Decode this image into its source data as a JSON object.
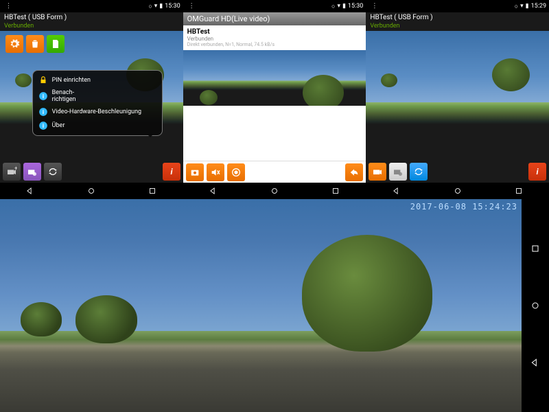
{
  "panel1": {
    "time": "15:30",
    "title": "HBTest ( USB Form )",
    "status": "Verbunden",
    "menu": {
      "pin": "PIN einrichten",
      "notify": "Benach-\nrichtigen",
      "hw": "Video-Hardware-Beschleunigung",
      "about": "Über"
    }
  },
  "panel2": {
    "time": "15:30",
    "header": "OMGuard HD(Live video)",
    "name": "HBTest",
    "conn_label": "Verbunden",
    "detail": "Direkt verbunden, N=1, Normal, 74.5 kB/s"
  },
  "panel3": {
    "time": "15:29",
    "title": "HBTest ( USB Form )",
    "status": "Verbunden"
  },
  "landscape": {
    "timestamp": "2017-06-08 15:24:23"
  },
  "icons": {
    "gear": "gear-icon",
    "trash": "trash-icon",
    "doc": "document-icon",
    "info": "info-icon",
    "camera_add": "camera-add-icon",
    "camera_settings": "camera-settings-icon",
    "refresh": "refresh-icon",
    "snapshot": "snapshot-icon",
    "mute": "mute-icon",
    "record": "record-icon",
    "back_arrow": "back-icon",
    "lock": "lock-icon"
  }
}
